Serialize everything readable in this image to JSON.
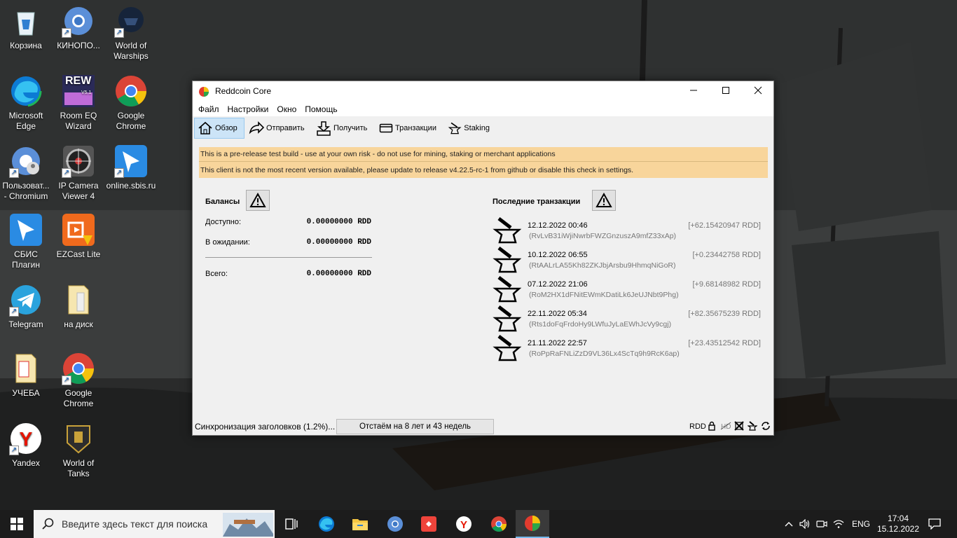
{
  "desktop": {
    "icons": [
      {
        "label": "Корзина"
      },
      {
        "label": "КИНОПО..."
      },
      {
        "label": "World of\nWarships"
      },
      {
        "label": "Microsoft\nEdge"
      },
      {
        "label": "Room EQ\nWizard"
      },
      {
        "label": "Google\nChrome"
      },
      {
        "label": "Пользоват...\n- Chromium"
      },
      {
        "label": "IP Camera\nViewer 4"
      },
      {
        "label": "online.sbis.ru"
      },
      {
        "label": "СБИС\nПлагин"
      },
      {
        "label": "EZCast Lite"
      },
      {
        "label": "Telegram"
      },
      {
        "label": "на диск"
      },
      {
        "label": "УЧЕБА"
      },
      {
        "label": "Google\nChrome"
      },
      {
        "label": "Yandex"
      },
      {
        "label": "World of\nTanks"
      }
    ],
    "rew_badge": "REW",
    "rew_version": "V5.1"
  },
  "window": {
    "title": "Reddcoin Core",
    "menu": [
      "Файл",
      "Настройки",
      "Окно",
      "Помощь"
    ],
    "toolbar": [
      "Обзор",
      "Отправить",
      "Получить",
      "Транзакции",
      "Staking"
    ],
    "alerts": [
      "This is a pre-release test build - use at your own risk - do not use for mining, staking or merchant applications",
      "This client is not the most recent version available, please update to release v4.22.5-rc-1 from github or disable this check in settings."
    ],
    "balances": {
      "title": "Балансы",
      "available_label": "Доступно:",
      "available_value": "0.00000000 RDD",
      "pending_label": "В ожидании:",
      "pending_value": "0.00000000 RDD",
      "total_label": "Всего:",
      "total_value": "0.00000000 RDD"
    },
    "recent": {
      "title": "Последние транзакции",
      "items": [
        {
          "date": "12.12.2022 00:46",
          "address": "(RvLvB31iWjiNwrbFWZGnzuszA9mfZ33xAp)",
          "amount": "[+62.15420947 RDD]"
        },
        {
          "date": "10.12.2022 06:55",
          "address": "(RtAALrLA55Kh82ZKJbjArsbu9HhmqNiGoR)",
          "amount": "[+0.23442758 RDD]"
        },
        {
          "date": "07.12.2022 21:06",
          "address": "(RoM2HX1dFNitEWmKDatiLk6JeUJNbt9Phg)",
          "amount": "[+9.68148982 RDD]"
        },
        {
          "date": "22.11.2022 05:34",
          "address": "(Rts1doFqFrdoHy9LWfuJyLaEWhJcVy9cgj)",
          "amount": "[+82.35675239 RDD]"
        },
        {
          "date": "21.11.2022 22:57",
          "address": "(RoPpRaFNLiZzD9VL36Lx4ScTq9h9RcK6ap)",
          "amount": "[+23.43512542 RDD]"
        }
      ]
    },
    "status": {
      "sync_label": "Синхронизация заголовков (1.2%)...",
      "progress_text": "Отстаём на 8 лет и 43 недель",
      "unit": "RDD"
    }
  },
  "taskbar": {
    "search_placeholder": "Введите здесь текст для поиска",
    "lang": "ENG",
    "time": "17:04",
    "date": "15.12.2022"
  }
}
